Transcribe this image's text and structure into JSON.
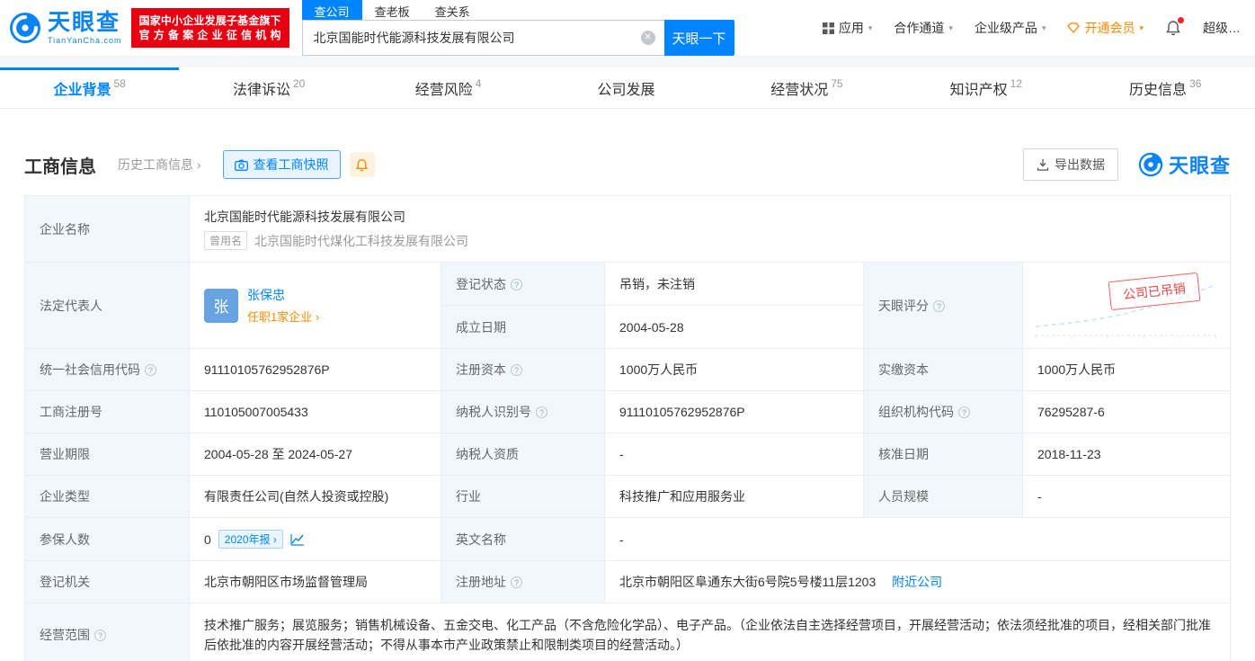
{
  "colors": {
    "brand_blue": "#0084ff",
    "logo_blue": "#0b83f1",
    "badge_red": "#e60012",
    "status_red": "#f04545",
    "member_orange": "#ff8a00",
    "label_bg": "#f1f8fc"
  },
  "icons": {
    "caret_down": "▾",
    "chevron_right": "›",
    "clear": "✕",
    "question": "?"
  },
  "header": {
    "logo": {
      "name": "天眼查",
      "domain": "TianYanCha.com"
    },
    "badge": {
      "line1": "国家中小企业发展子基金旗下",
      "line2": "官方备案企业征信机构"
    },
    "search": {
      "tabs": [
        {
          "label": "查公司"
        },
        {
          "label": "查老板"
        },
        {
          "label": "查关系"
        }
      ],
      "value": "北京国能时代能源科技发展有限公司",
      "button": "天眼一下"
    },
    "nav": {
      "apps": "应用",
      "partner": "合作通道",
      "enterprise": "企业级产品",
      "member": "开通会员",
      "super": "超级…"
    }
  },
  "tabs": [
    {
      "label": "企业背景",
      "count": "58"
    },
    {
      "label": "法律诉讼",
      "count": "20"
    },
    {
      "label": "经营风险",
      "count": "4"
    },
    {
      "label": "公司发展",
      "count": ""
    },
    {
      "label": "经营状况",
      "count": "75"
    },
    {
      "label": "知识产权",
      "count": "12"
    },
    {
      "label": "历史信息",
      "count": "36"
    }
  ],
  "section": {
    "title": "工商信息",
    "history": "历史工商信息",
    "snapshot": "查看工商快照",
    "export": "导出数据",
    "brand": "天眼查"
  },
  "table": {
    "company_name": {
      "label": "企业名称",
      "value": "北京国能时代能源科技发展有限公司",
      "former_tag": "曾用名",
      "former": "北京国能时代煤化工科技发展有限公司"
    },
    "legal_rep": {
      "label": "法定代表人",
      "avatar": "张",
      "name": "张保忠",
      "link": "任职1家企业"
    },
    "reg_status": {
      "label": "登记状态",
      "value": "吊销，未注销"
    },
    "establish_date": {
      "label": "成立日期",
      "value": "2004-05-28"
    },
    "score": {
      "label": "天眼评分",
      "stamp": "公司已吊销"
    },
    "credit_code": {
      "label": "统一社会信用代码",
      "value": "91110105762952876P"
    },
    "reg_capital": {
      "label": "注册资本",
      "value": "1000万人民币"
    },
    "paid_capital": {
      "label": "实缴资本",
      "value": "1000万人民币"
    },
    "reg_number": {
      "label": "工商注册号",
      "value": "110105007005433"
    },
    "taxpayer_id": {
      "label": "纳税人识别号",
      "value": "91110105762952876P"
    },
    "org_code": {
      "label": "组织机构代码",
      "value": "76295287-6"
    },
    "business_term": {
      "label": "营业期限",
      "value": "2004-05-28 至 2024-05-27"
    },
    "taxpayer_quality": {
      "label": "纳税人资质",
      "value": "-"
    },
    "approval_date": {
      "label": "核准日期",
      "value": "2018-11-23"
    },
    "company_type": {
      "label": "企业类型",
      "value": "有限责任公司(自然人投资或控股)"
    },
    "industry": {
      "label": "行业",
      "value": "科技推广和应用服务业"
    },
    "staff_size": {
      "label": "人员规模",
      "value": "-"
    },
    "insured": {
      "label": "参保人数",
      "value": "0",
      "report": "2020年报"
    },
    "english_name": {
      "label": "英文名称",
      "value": "-"
    },
    "reg_authority": {
      "label": "登记机关",
      "value": "北京市朝阳区市场监督管理局"
    },
    "reg_address": {
      "label": "注册地址",
      "value": "北京市朝阳区阜通东大街6号院5号楼11层1203",
      "nearby": "附近公司"
    },
    "business_scope": {
      "label": "经营范围",
      "value": "技术推广服务；展览服务；销售机械设备、五金交电、化工产品（不含危险化学品）、电子产品。（企业依法自主选择经营项目，开展经营活动；依法须经批准的项目，经相关部门批准后依批准的内容开展经营活动；不得从事本市产业政策禁止和限制类项目的经营活动。）"
    }
  }
}
